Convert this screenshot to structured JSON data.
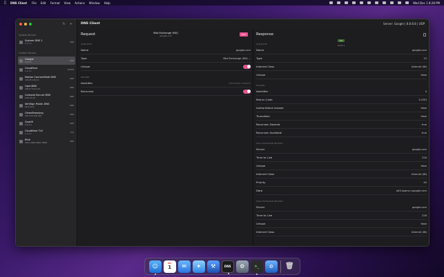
{
  "menubar": {
    "app": "DNS Client",
    "items": [
      "File",
      "Edit",
      "Format",
      "View",
      "Actions",
      "Window",
      "Help"
    ],
    "clock": "Wed Dec 1  8:28 PM"
  },
  "window": {
    "title": "DNS Client",
    "server_summary": "Server: Google | 8.8.8.8 | UDP"
  },
  "sidebar": {
    "system_section": "System Servers",
    "custom_section": "Custom Servers",
    "system_servers": [
      {
        "name": "System DNS 1",
        "addr": "1.1.1.1",
        "proto": "UDP"
      }
    ],
    "custom_servers": [
      {
        "name": "Google",
        "addr": "8.8.8.8",
        "proto": "UDP"
      },
      {
        "name": "Cloudflare",
        "addr": "1.1.1.1",
        "proto": "HTTPS"
      },
      {
        "name": "Norton ConnectSafe DNS",
        "addr": "199.85.126.10",
        "proto": "UDP"
      },
      {
        "name": "OpenDNS",
        "addr": "208.67.222.123",
        "proto": "UDP"
      },
      {
        "name": "Comodo Secure DNS",
        "addr": "8.26.56.26",
        "proto": "UDP"
      },
      {
        "name": "VeriSign Public DNS",
        "addr": "64.6.64.6",
        "proto": "UDP"
      },
      {
        "name": "CleanBrowsing",
        "addr": "185.228.168.168",
        "proto": "UDP"
      },
      {
        "name": "Quad9",
        "addr": "9.9.9.9",
        "proto": "UDP"
      },
      {
        "name": "Cloudflare TLS",
        "addr": "1.1.1.1",
        "proto": "TLS"
      },
      {
        "name": "IPv6",
        "addr": "2001:4860:4860::8888",
        "proto": "UDP"
      }
    ]
  },
  "request": {
    "heading": "Request",
    "type_title": "Mail Exchange (MX)",
    "type_domain": "google.com",
    "run_label": "Run",
    "question_section": "QUESTION",
    "header_section": "HEADER",
    "name_label": "Name",
    "name_value": "google.com",
    "type_label": "Type",
    "type_value": "Mail Exchange (MX)",
    "unique_label": "Unique",
    "identifier_label": "Identifier",
    "identifier_placeholder": "Generate random",
    "recursive_label": "Recursive"
  },
  "response": {
    "heading": "Response",
    "status": "OK",
    "time": "0.023 s",
    "question_section": "QUESTION",
    "header_section": "HEADER",
    "q_rows": [
      {
        "k": "Name",
        "v": "google.com"
      },
      {
        "k": "Type",
        "v": "15"
      },
      {
        "k": "Internet Class",
        "v": "Internet (IN)"
      },
      {
        "k": "Unique",
        "v": "false"
      }
    ],
    "h_rows": [
      {
        "k": "Identifier",
        "v": "0"
      },
      {
        "k": "Return Code",
        "v": "0 (OK)"
      },
      {
        "k": "Authoritative Answer",
        "v": "false"
      },
      {
        "k": "Truncation",
        "v": "false"
      },
      {
        "k": "Recursion Desired",
        "v": "true"
      },
      {
        "k": "Recursion Available",
        "v": "true"
      }
    ],
    "mx1_section": "MAIL EXCHANGE RECORD",
    "mx1_rows": [
      {
        "k": "Server",
        "v": "google.com"
      },
      {
        "k": "Time to Live",
        "v": "226"
      },
      {
        "k": "Unique",
        "v": "false"
      },
      {
        "k": "Internet Class",
        "v": "Internet (IN)"
      },
      {
        "k": "Priority",
        "v": "40"
      },
      {
        "k": "Data",
        "v": "alt3.aspmx.l.google.com"
      }
    ],
    "mx2_section": "MAIL EXCHANGE RECORD",
    "mx2_rows": [
      {
        "k": "Server",
        "v": "google.com"
      },
      {
        "k": "Time to Live",
        "v": "226"
      },
      {
        "k": "Unique",
        "v": "false"
      },
      {
        "k": "Internet Class",
        "v": "Internet (IN)"
      }
    ]
  },
  "dock": {
    "calendar_month": "DEC",
    "calendar_day": "1",
    "dns_label": "DNS",
    "items": [
      "finder-icon",
      "calendar-icon",
      "mail-icon",
      "safari-icon",
      "xcode-icon",
      "dns-client-icon",
      "system-preferences-icon",
      "terminal-icon",
      "instruments-icon",
      "trash-icon"
    ]
  },
  "colors": {
    "accent": "#e8548f",
    "status_ok": "#3f6e33",
    "window_bg": "#1e1e20",
    "sidebar_bg": "#262528"
  }
}
